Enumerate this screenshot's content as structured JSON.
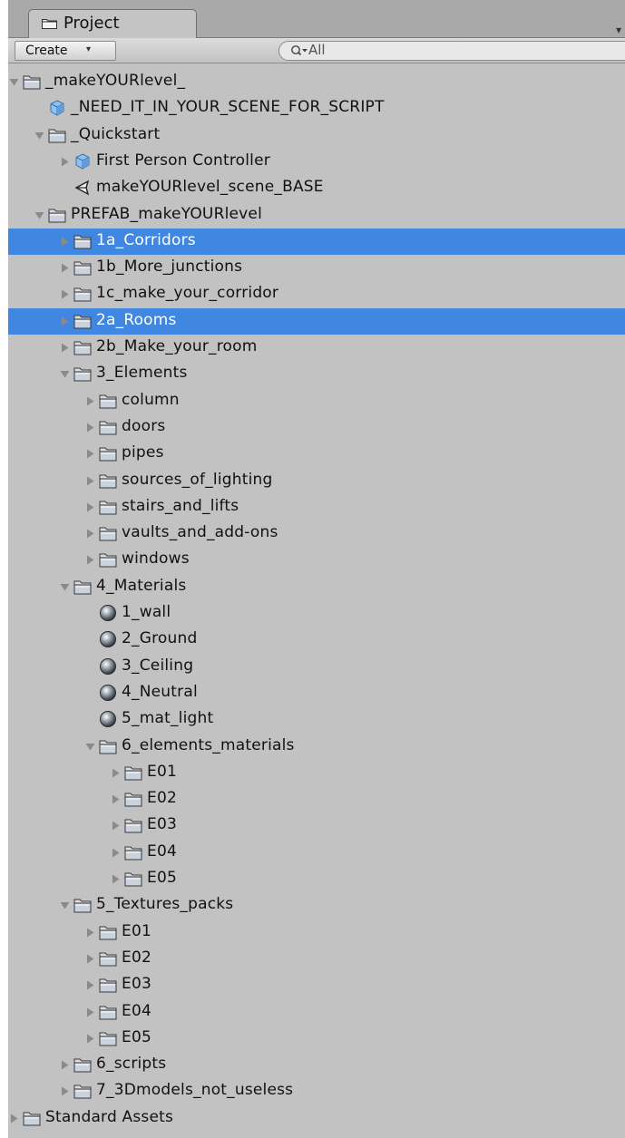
{
  "panel": {
    "tab_label": "Project",
    "toolbar": {
      "create_label": "Create",
      "search_value": "All"
    }
  },
  "colors": {
    "selection": "#3f87e0",
    "tree_background": "#c2c2c2",
    "tab_bar": "#a9a9a9"
  },
  "tree": {
    "items": [
      {
        "label": "_makeYOURlevel_",
        "depth": 0,
        "kind": "folder",
        "arrow": "expanded",
        "selected": false
      },
      {
        "label": "_NEED_IT_IN_YOUR_SCENE_FOR_SCRIPT",
        "depth": 1,
        "kind": "prefab",
        "arrow": "none",
        "selected": false
      },
      {
        "label": "_Quickstart",
        "depth": 1,
        "kind": "folder",
        "arrow": "expanded",
        "selected": false
      },
      {
        "label": "First Person Controller",
        "depth": 2,
        "kind": "prefab",
        "arrow": "collapsed",
        "selected": false
      },
      {
        "label": "makeYOURlevel_scene_BASE",
        "depth": 2,
        "kind": "scene",
        "arrow": "none",
        "selected": false
      },
      {
        "label": "PREFAB_makeYOURlevel",
        "depth": 1,
        "kind": "folder",
        "arrow": "expanded",
        "selected": false
      },
      {
        "label": "1a_Corridors",
        "depth": 2,
        "kind": "folder",
        "arrow": "collapsed",
        "selected": true
      },
      {
        "label": "1b_More_junctions",
        "depth": 2,
        "kind": "folder",
        "arrow": "collapsed",
        "selected": false
      },
      {
        "label": "1c_make_your_corridor",
        "depth": 2,
        "kind": "folder",
        "arrow": "collapsed",
        "selected": false
      },
      {
        "label": "2a_Rooms",
        "depth": 2,
        "kind": "folder",
        "arrow": "collapsed",
        "selected": true
      },
      {
        "label": "2b_Make_your_room",
        "depth": 2,
        "kind": "folder",
        "arrow": "collapsed",
        "selected": false
      },
      {
        "label": "3_Elements",
        "depth": 2,
        "kind": "folder",
        "arrow": "expanded",
        "selected": false
      },
      {
        "label": "column",
        "depth": 3,
        "kind": "folder",
        "arrow": "collapsed",
        "selected": false
      },
      {
        "label": "doors",
        "depth": 3,
        "kind": "folder",
        "arrow": "collapsed",
        "selected": false
      },
      {
        "label": "pipes",
        "depth": 3,
        "kind": "folder",
        "arrow": "collapsed",
        "selected": false
      },
      {
        "label": "sources_of_lighting",
        "depth": 3,
        "kind": "folder",
        "arrow": "collapsed",
        "selected": false
      },
      {
        "label": "stairs_and_lifts",
        "depth": 3,
        "kind": "folder",
        "arrow": "collapsed",
        "selected": false
      },
      {
        "label": "vaults_and_add-ons",
        "depth": 3,
        "kind": "folder",
        "arrow": "collapsed",
        "selected": false
      },
      {
        "label": "windows",
        "depth": 3,
        "kind": "folder",
        "arrow": "collapsed",
        "selected": false
      },
      {
        "label": "4_Materials",
        "depth": 2,
        "kind": "folder",
        "arrow": "expanded",
        "selected": false
      },
      {
        "label": "1_wall",
        "depth": 3,
        "kind": "material",
        "arrow": "none",
        "selected": false
      },
      {
        "label": "2_Ground",
        "depth": 3,
        "kind": "material",
        "arrow": "none",
        "selected": false
      },
      {
        "label": "3_Ceiling",
        "depth": 3,
        "kind": "material",
        "arrow": "none",
        "selected": false
      },
      {
        "label": "4_Neutral",
        "depth": 3,
        "kind": "material",
        "arrow": "none",
        "selected": false
      },
      {
        "label": "5_mat_light",
        "depth": 3,
        "kind": "material",
        "arrow": "none",
        "selected": false
      },
      {
        "label": "6_elements_materials",
        "depth": 3,
        "kind": "folder",
        "arrow": "expanded",
        "selected": false
      },
      {
        "label": "E01",
        "depth": 4,
        "kind": "folder",
        "arrow": "collapsed",
        "selected": false
      },
      {
        "label": "E02",
        "depth": 4,
        "kind": "folder",
        "arrow": "collapsed",
        "selected": false
      },
      {
        "label": "E03",
        "depth": 4,
        "kind": "folder",
        "arrow": "collapsed",
        "selected": false
      },
      {
        "label": "E04",
        "depth": 4,
        "kind": "folder",
        "arrow": "collapsed",
        "selected": false
      },
      {
        "label": "E05",
        "depth": 4,
        "kind": "folder",
        "arrow": "collapsed",
        "selected": false
      },
      {
        "label": "5_Textures_packs",
        "depth": 2,
        "kind": "folder",
        "arrow": "expanded",
        "selected": false
      },
      {
        "label": "E01",
        "depth": 3,
        "kind": "folder",
        "arrow": "collapsed",
        "selected": false
      },
      {
        "label": "E02",
        "depth": 3,
        "kind": "folder",
        "arrow": "collapsed",
        "selected": false
      },
      {
        "label": "E03",
        "depth": 3,
        "kind": "folder",
        "arrow": "collapsed",
        "selected": false
      },
      {
        "label": "E04",
        "depth": 3,
        "kind": "folder",
        "arrow": "collapsed",
        "selected": false
      },
      {
        "label": "E05",
        "depth": 3,
        "kind": "folder",
        "arrow": "collapsed",
        "selected": false
      },
      {
        "label": "6_scripts",
        "depth": 2,
        "kind": "folder",
        "arrow": "collapsed",
        "selected": false
      },
      {
        "label": "7_3Dmodels_not_useless",
        "depth": 2,
        "kind": "folder",
        "arrow": "collapsed",
        "selected": false
      },
      {
        "label": "Standard Assets",
        "depth": 0,
        "kind": "folder",
        "arrow": "collapsed",
        "selected": false
      }
    ]
  }
}
